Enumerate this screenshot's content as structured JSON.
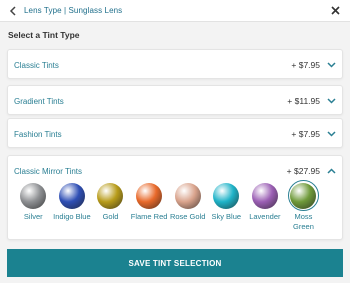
{
  "header": {
    "breadcrumb": "Lens Type | Sunglass Lens"
  },
  "section": {
    "heading": "Select a Tint Type"
  },
  "tints": [
    {
      "title": "Classic Tints",
      "price": "+ $7.95",
      "expanded": false
    },
    {
      "title": "Gradient Tints",
      "price": "+ $11.95",
      "expanded": false
    },
    {
      "title": "Fashion Tints",
      "price": "+ $7.95",
      "expanded": false
    },
    {
      "title": "Classic Mirror Tints",
      "price": "+ $27.95",
      "expanded": true
    }
  ],
  "mirror_options": [
    {
      "label": "Silver",
      "color": "#8e9093",
      "selected": false
    },
    {
      "label": "Indigo Blue",
      "color": "#2f4fb5",
      "selected": false
    },
    {
      "label": "Gold",
      "color": "#b89c1a",
      "selected": false
    },
    {
      "label": "Flame Red",
      "color": "#e8692a",
      "selected": false
    },
    {
      "label": "Rose Gold",
      "color": "#d9a38c",
      "selected": false
    },
    {
      "label": "Sky Blue",
      "color": "#1fb3c8",
      "selected": false
    },
    {
      "label": "Lavender",
      "color": "#9b5fb4",
      "selected": false
    },
    {
      "label": "Moss Green",
      "color": "#6f9a3a",
      "selected": true
    }
  ],
  "save_button": {
    "label": "SAVE TINT SELECTION"
  },
  "colors": {
    "accent": "#2a7f93",
    "button": "#1b8290",
    "background": "#f3f3f3"
  }
}
